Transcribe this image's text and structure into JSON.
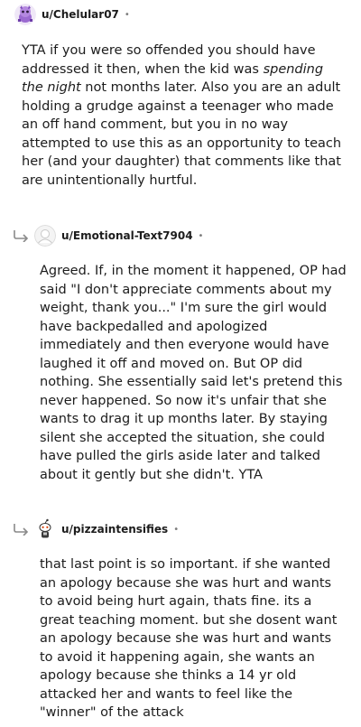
{
  "comments": [
    {
      "username": "u/Chelular07",
      "separator": "•",
      "avatar": "purple-snoo-avatar",
      "body_before_italic": "YTA if you were so offended you should have addressed it then, when the kid was ",
      "body_italic": "spending the night",
      "body_after_italic": " not months later. Also you are an adult holding a grudge against a teenager who made an off hand comment, but you in no way attempted to use this as an opportunity to teach her (and your daughter) that comments like that are unintentionally hurtful."
    },
    {
      "username": "u/Emotional-Text7904",
      "separator": "•",
      "avatar": "default-gray-avatar",
      "reply_icon": "reply-arrow-icon",
      "body": "Agreed. If, in the moment it happened, OP had said \"I don't appreciate comments about my weight, thank you...\" I'm sure the girl would have backpedalled and apologized immediately and then everyone would have laughed it off and moved on. But OP did nothing. She essentially said let's pretend this never happened. So now it's unfair that she wants to drag it up months later. By staying silent she accepted the situation, she could have pulled the girls aside later and talked about it gently but she didn't. YTA"
    },
    {
      "username": "u/pizzaintensifies",
      "separator": "•",
      "avatar": "snoo-avatar",
      "reply_icon": "reply-arrow-icon",
      "body": "that last point is so important. if she wanted an apology because she was hurt and wants to avoid being hurt again, thats fine. its a great teaching moment. but she dosent want an apology because she was hurt and wants to avoid it happening again, she wants an apology because she thinks a 14 yr old attacked her and wants to feel like the \"winner\" of the attack"
    }
  ]
}
